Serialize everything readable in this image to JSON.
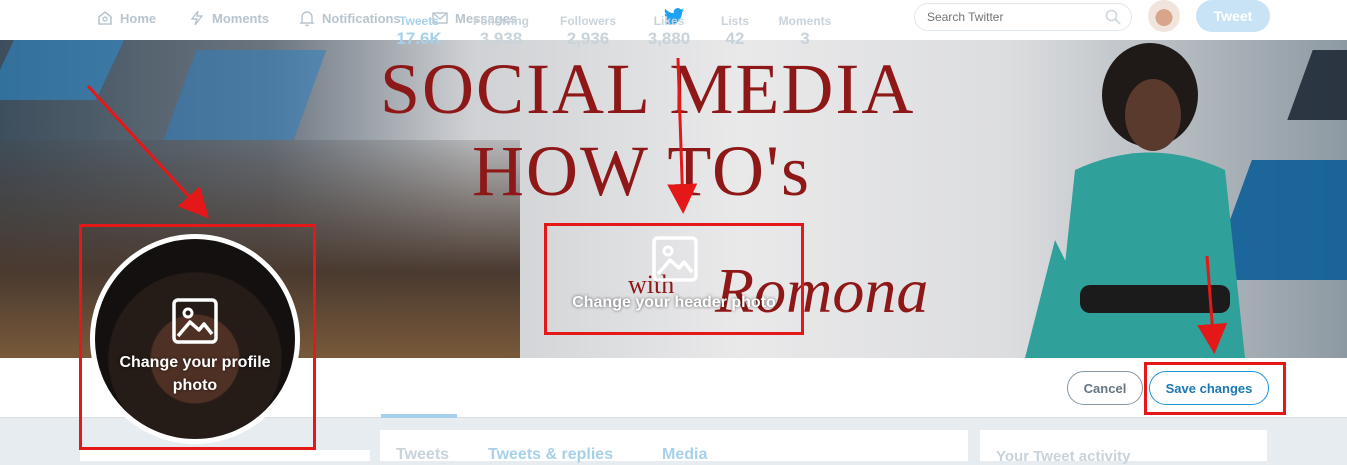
{
  "nav": {
    "home": "Home",
    "moments": "Moments",
    "notifications": "Notifications",
    "messages": "Messages",
    "search_placeholder": "Search Twitter",
    "tweet_button": "Tweet"
  },
  "header_banner": {
    "line1": "SOCIAL MEDIA",
    "line2": "HOW TO's",
    "with": "with",
    "script": "Romona"
  },
  "edit_overlays": {
    "header_photo": "Change your header photo",
    "profile_photo": "Change your profile photo"
  },
  "stats": [
    {
      "label": "Tweets",
      "value": "17.6K"
    },
    {
      "label": "Following",
      "value": "3,938"
    },
    {
      "label": "Followers",
      "value": "2,936"
    },
    {
      "label": "Likes",
      "value": "3,880"
    },
    {
      "label": "Lists",
      "value": "42"
    },
    {
      "label": "Moments",
      "value": "3"
    }
  ],
  "actions": {
    "cancel": "Cancel",
    "save": "Save changes"
  },
  "timeline_tabs": [
    "Tweets",
    "Tweets & replies",
    "Media"
  ],
  "sidebar_right_title": "Your Tweet activity",
  "colors": {
    "annotation_red": "#e41818",
    "twitter_blue": "#1b95e0",
    "banner_red": "#8e1818"
  }
}
